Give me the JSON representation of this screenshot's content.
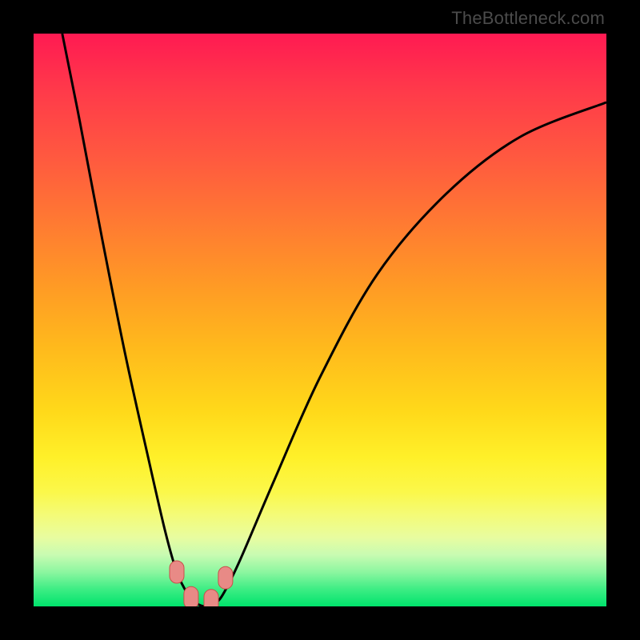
{
  "attribution": "TheBottleneck.com",
  "chart_data": {
    "type": "line",
    "title": "",
    "xlabel": "",
    "ylabel": "",
    "xlim": [
      0,
      100
    ],
    "ylim": [
      0,
      100
    ],
    "series": [
      {
        "name": "bottleneck-curve",
        "x": [
          5,
          8,
          12,
          16,
          20,
          23,
          25,
          27,
          28.5,
          30,
          31.5,
          33,
          36,
          42,
          50,
          60,
          72,
          85,
          100
        ],
        "y": [
          100,
          85,
          64,
          44,
          26,
          13,
          6,
          2,
          0.5,
          0,
          0.5,
          2,
          8,
          22,
          40,
          58,
          72,
          82,
          88
        ]
      }
    ],
    "markers": [
      {
        "name": "marker-left",
        "x": 25.0,
        "y": 6.0
      },
      {
        "name": "marker-bottom-left",
        "x": 27.5,
        "y": 1.5
      },
      {
        "name": "marker-bottom-right",
        "x": 31.0,
        "y": 1.0
      },
      {
        "name": "marker-right",
        "x": 33.5,
        "y": 5.0
      }
    ],
    "colors": {
      "curve": "#000000",
      "marker_fill": "#e88a86",
      "marker_stroke": "#c94f4a",
      "gradient_top": "#ff1a52",
      "gradient_bottom": "#00e36c"
    }
  }
}
